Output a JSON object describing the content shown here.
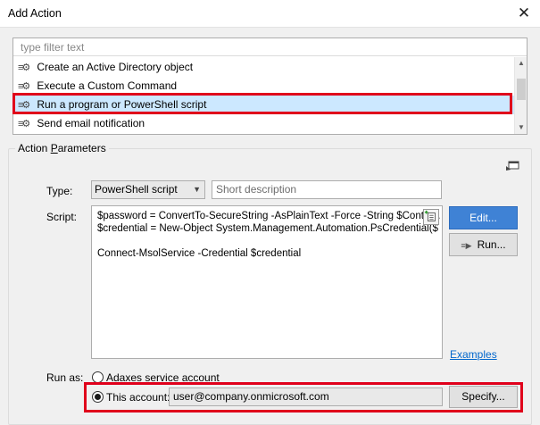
{
  "window": {
    "title": "Add Action",
    "close_glyph": "✕"
  },
  "filter": {
    "placeholder": "type filter text",
    "value": ""
  },
  "actions_list": {
    "items": [
      {
        "label": "Create an Active Directory object",
        "icon": "gear-icon",
        "selected": false
      },
      {
        "label": "Execute a Custom Command",
        "icon": "gear-icon",
        "selected": false
      },
      {
        "label": "Run a program or PowerShell script",
        "icon": "gear-icon",
        "selected": true
      },
      {
        "label": "Send email notification",
        "icon": "gear-icon",
        "selected": false
      }
    ]
  },
  "parameters": {
    "group_title_prefix": "Action ",
    "group_title_accel": "P",
    "group_title_suffix": "arameters",
    "type_label": "Type:",
    "type_value": "PowerShell script",
    "description_placeholder": "Short description",
    "script_label": "Script:",
    "script_lines": [
      "$password = ConvertTo-SecureString -AsPlainText -Force -String $Context.",
      "$credential = New-Object System.Management.Automation.PsCredential($",
      "",
      "Connect-MsolService -Credential $credential"
    ],
    "edit_button": "Edit...",
    "run_button": "Run...",
    "examples_link": "Examples",
    "run_as_label": "Run as:",
    "service_account_option": "Adaxes service account",
    "this_account_option": "This account:",
    "account_value": "user@company.onmicrosoft.com",
    "specify_button": "Specify...",
    "selected_run_as": "This account:"
  },
  "colors": {
    "accent": "#3f82d5",
    "highlight": "#e0001b",
    "selection": "#cce8ff"
  }
}
